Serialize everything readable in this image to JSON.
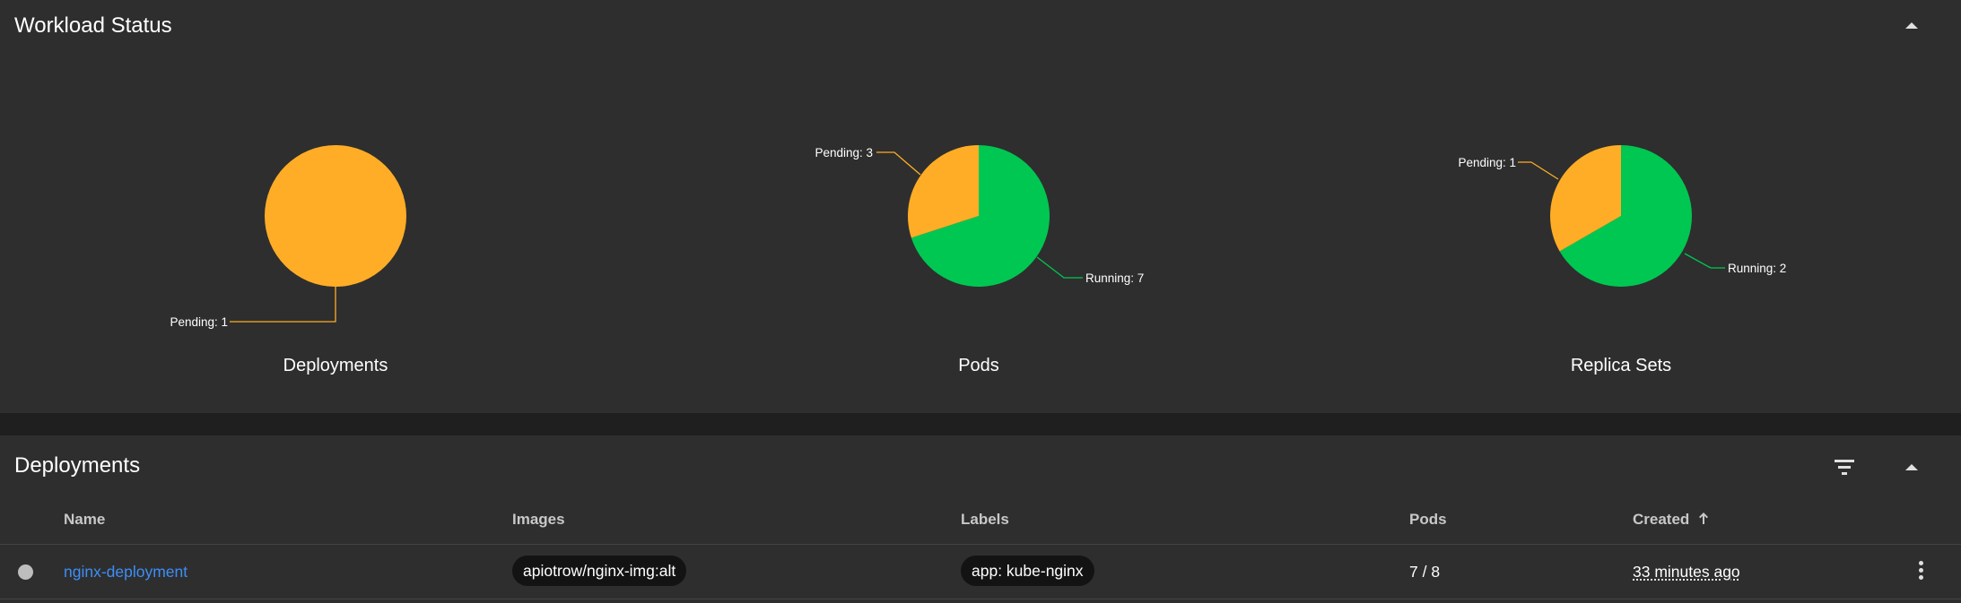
{
  "workload_status": {
    "title": "Workload Status",
    "collapse_icon": "chevron-up-icon"
  },
  "chart_data": [
    {
      "type": "pie",
      "title": "Deployments",
      "slices": [
        {
          "label": "Pending",
          "value": 1,
          "color": "#ffad26"
        }
      ]
    },
    {
      "type": "pie",
      "title": "Pods",
      "slices": [
        {
          "label": "Running",
          "value": 7,
          "color": "#00c752"
        },
        {
          "label": "Pending",
          "value": 3,
          "color": "#ffad26"
        }
      ]
    },
    {
      "type": "pie",
      "title": "Replica Sets",
      "slices": [
        {
          "label": "Running",
          "value": 2,
          "color": "#00c752"
        },
        {
          "label": "Pending",
          "value": 1,
          "color": "#ffad26"
        }
      ]
    }
  ],
  "deployments": {
    "title": "Deployments",
    "filter_icon": "filter-icon",
    "collapse_icon": "chevron-up-icon",
    "columns": {
      "name": "Name",
      "images": "Images",
      "labels": "Labels",
      "pods": "Pods",
      "created": "Created",
      "sort_icon": "arrow-up-icon"
    },
    "rows": [
      {
        "name": "nginx-deployment",
        "image": "apiotrow/nginx-img:alt",
        "label": "app: kube-nginx",
        "pods": "7 / 8",
        "created": "33 minutes ago"
      }
    ]
  },
  "colors": {
    "background": "#1f1f1f",
    "card": "#2e2e2e",
    "pending": "#ffad26",
    "running": "#00c752",
    "link": "#3e8ef7"
  }
}
